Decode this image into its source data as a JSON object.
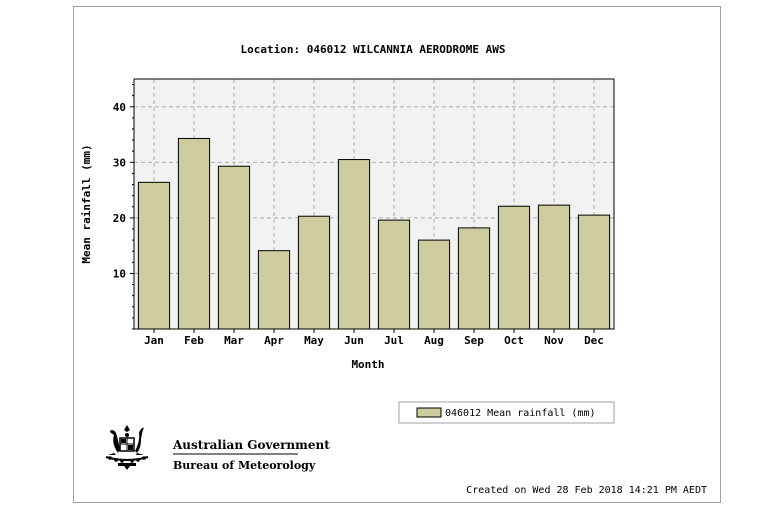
{
  "chart_data": {
    "type": "bar",
    "title": "Location: 046012 WILCANNIA AERODROME AWS",
    "xlabel": "Month",
    "ylabel": "Mean rainfall (mm)",
    "categories": [
      "Jan",
      "Feb",
      "Mar",
      "Apr",
      "May",
      "Jun",
      "Jul",
      "Aug",
      "Sep",
      "Oct",
      "Nov",
      "Dec"
    ],
    "series": [
      {
        "name": "046012 Mean rainfall (mm)",
        "values": [
          26.4,
          34.3,
          29.3,
          14.1,
          20.3,
          30.5,
          19.6,
          16.0,
          18.2,
          22.1,
          22.3,
          20.5
        ]
      }
    ],
    "ylim": [
      0,
      45
    ],
    "yticks": [
      10,
      20,
      30,
      40
    ],
    "grid": true,
    "legend_position": "bottom-right",
    "colors": {
      "bar_fill": "#cccc9e",
      "bar_stroke": "#000000",
      "plot_background": "#f2f2f2",
      "grid": "#b0b0b0"
    }
  },
  "logo": {
    "line1": "Australian Government",
    "line2": "Bureau of Meteorology"
  },
  "footer": {
    "created": "Created on Wed 28 Feb 2018 14:21 PM AEDT"
  }
}
